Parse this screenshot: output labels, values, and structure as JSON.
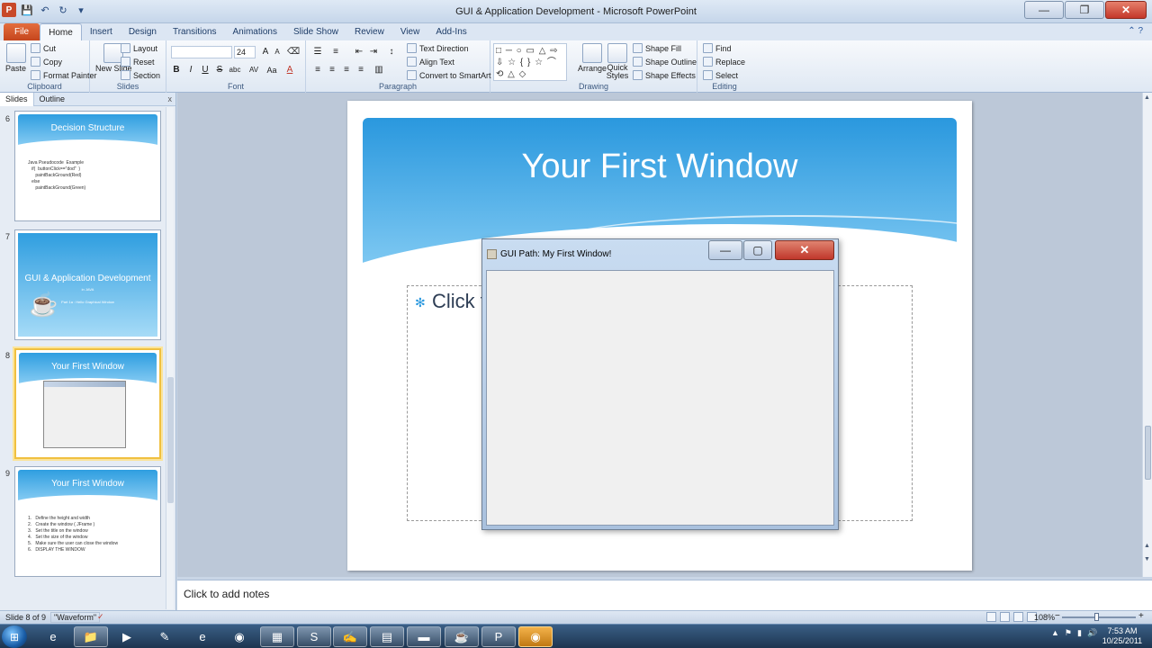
{
  "window": {
    "title": "GUI & Application Development  -  Microsoft PowerPoint",
    "app_letter": "P",
    "minimize": "—",
    "maximize": "❐",
    "close": "✕"
  },
  "ribbon_tabs": [
    "File",
    "Home",
    "Insert",
    "Design",
    "Transitions",
    "Animations",
    "Slide Show",
    "Review",
    "View",
    "Add-Ins"
  ],
  "ribbon": {
    "clipboard": {
      "label": "Clipboard",
      "paste": "Paste",
      "cut": "Cut",
      "copy": "Copy",
      "format_painter": "Format Painter"
    },
    "slides": {
      "label": "Slides",
      "new_slide": "New Slide",
      "layout": "Layout",
      "reset": "Reset",
      "section": "Section"
    },
    "font": {
      "label": "Font",
      "size": "24",
      "bold": "B",
      "italic": "I",
      "underline": "U",
      "strike": "S",
      "shadow": "abc",
      "spacing": "AV",
      "case": "Aa",
      "grow": "A",
      "shrink": "A",
      "color": "A"
    },
    "paragraph": {
      "label": "Paragraph",
      "text_direction": "Text Direction",
      "align_text": "Align Text",
      "convert_smartart": "Convert to SmartArt"
    },
    "drawing": {
      "label": "Drawing",
      "arrange": "Arrange",
      "quick_styles": "Quick Styles",
      "shape_fill": "Shape Fill",
      "shape_outline": "Shape Outline",
      "shape_effects": "Shape Effects",
      "shapes": "□ ─ ○ ▭ △ ⇨ ⇩ ☆ { } ☆ ⌒ ⟲ △ ◇"
    },
    "editing": {
      "label": "Editing",
      "find": "Find",
      "replace": "Replace",
      "select": "Select"
    }
  },
  "slides_pane": {
    "tabs": [
      "Slides",
      "Outline"
    ],
    "close": "x",
    "thumbnails": [
      {
        "number": "6",
        "title": "Decision Structure",
        "body": "Java Pseudocode  Example\n   if(  buttonClick==\"dod\"  )\n      paintBackGround(Red)\n   else\n      paintBackGround(Green)"
      },
      {
        "number": "7",
        "title": "GUI & Application Development",
        "subtitle": "in JAVA",
        "note": "Part 1a : Hello Graphical Window"
      },
      {
        "number": "8",
        "title": "Your First Window"
      },
      {
        "number": "9",
        "title": "Your First Window",
        "body": "1.   Define the height and width\n2.   Create the window ( JFrame )\n3.   Set the title on the window\n4.   Set the size of the window\n5.   Make sure the user can close the window\n6.   DISPLAY THE WINDOW"
      }
    ]
  },
  "slide": {
    "title": "Your First Window",
    "placeholder_text": "Click t",
    "bullet": "✻"
  },
  "java_window": {
    "title": "GUI Path:  My First Window!",
    "minimize": "—",
    "maximize": "▢",
    "close": "✕"
  },
  "notes": {
    "placeholder": "Click to add notes"
  },
  "status": {
    "slide_position": "Slide 8 of 9",
    "theme": "\"Waveform\"",
    "spell_icon": "✓",
    "zoom": "108%",
    "zoom_out": "−",
    "zoom_in": "+"
  },
  "taskbar": {
    "start": "⊞",
    "items": [
      "e",
      "📁",
      "▶",
      "✎",
      "e",
      "◉",
      "▦",
      "S",
      "✍",
      "▤",
      "▬",
      "☕",
      "P",
      "◉"
    ],
    "tray": [
      "▲",
      "⚑",
      "▮",
      "🔊"
    ],
    "time": "7:53 AM",
    "date": "10/25/2011"
  },
  "colors": {
    "accent": "#2a98de",
    "file_tab": "#d2542a",
    "close_red": "#c4372a"
  }
}
